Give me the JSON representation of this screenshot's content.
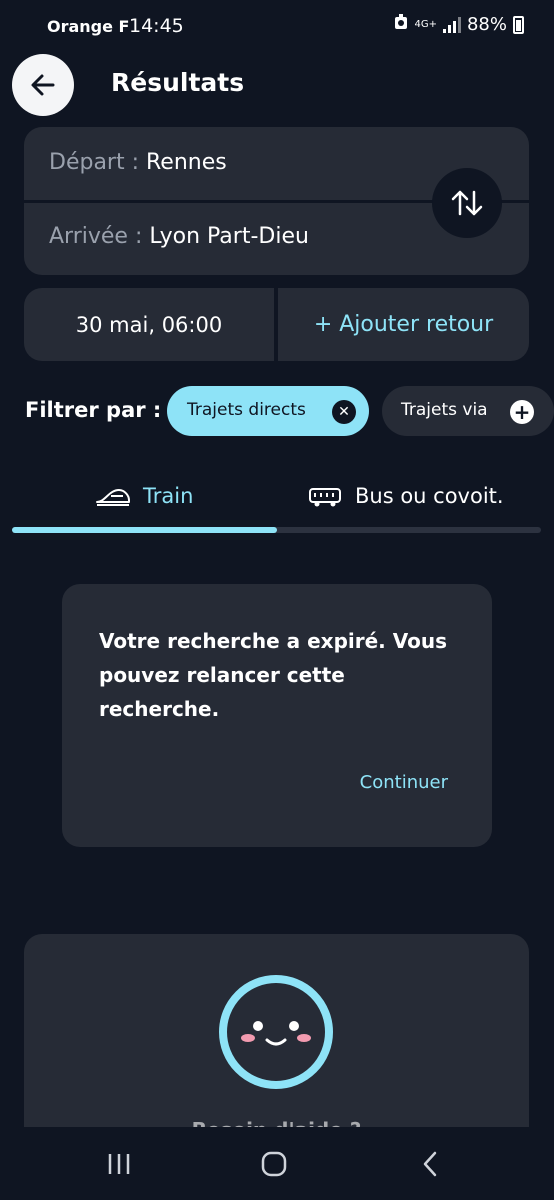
{
  "status_bar": {
    "carrier": "Orange F",
    "time": "14:45",
    "network": "4G+",
    "battery": "88%"
  },
  "header": {
    "title": "Résultats",
    "back_icon": "arrow-left-icon"
  },
  "route": {
    "departure_label": "Départ :",
    "departure_value": "Rennes",
    "arrival_label": "Arrivée :",
    "arrival_value": "Lyon Part-Dieu",
    "swap_icon": "swap-vertical-icon"
  },
  "dates": {
    "outbound": "30 mai, 06:00",
    "add_return": "+ Ajouter retour"
  },
  "filters": {
    "label": "Filtrer par :",
    "chips": [
      {
        "label": "Trajets directs",
        "active": true,
        "icon": "close-icon"
      },
      {
        "label": "Trajets via",
        "active": false,
        "icon": "plus-icon"
      }
    ]
  },
  "tabs": [
    {
      "label": "Train",
      "icon": "train-icon",
      "selected": true
    },
    {
      "label": "Bus ou covoit.",
      "icon": "bus-icon",
      "selected": false
    }
  ],
  "dialog": {
    "message": "Votre recherche a expiré. Vous pouvez relancer cette recherche.",
    "action": "Continuer"
  },
  "feedback": {
    "icon": "smiley-icon",
    "text": "Besoin d'aide ?"
  },
  "colors": {
    "background": "#0f1522",
    "card": "#262b36",
    "accent": "#8ee3f7"
  }
}
